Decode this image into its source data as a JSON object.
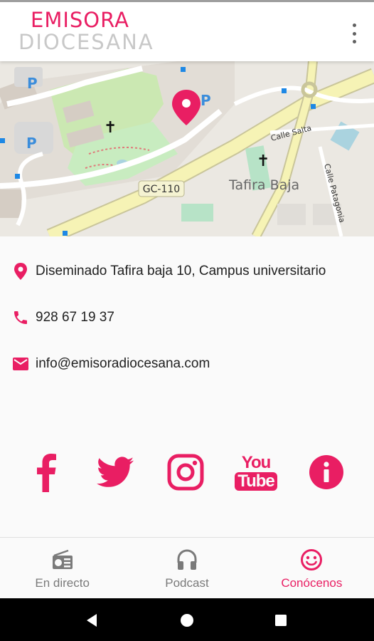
{
  "app": {
    "logo_line1": "EMISORA",
    "logo_line2": "DIOCESANA",
    "menu_icon": "more-vert-icon"
  },
  "map": {
    "road_label": "GC-110",
    "place_label": "Tafira Baja",
    "street1": "Calle Salta",
    "street2": "Calle Patagonia",
    "parking": "P"
  },
  "contact": {
    "address": "Diseminado Tafira baja 10, Campus universitario",
    "phone": "928 67 19 37",
    "email": "info@emisoradiocesana.com"
  },
  "social": {
    "facebook": "f",
    "youtube_you": "You",
    "youtube_tube": "Tube",
    "info": "i"
  },
  "nav": {
    "items": [
      {
        "label": "En directo",
        "icon": "radio-icon"
      },
      {
        "label": "Podcast",
        "icon": "headphones-icon"
      },
      {
        "label": "Conócenos",
        "icon": "smiley-icon"
      }
    ],
    "active": "Conócenos"
  },
  "colors": {
    "accent": "#e91e63",
    "road": "#f6f3b5",
    "park": "#d9f2c4",
    "building": "#d9d0c9"
  }
}
